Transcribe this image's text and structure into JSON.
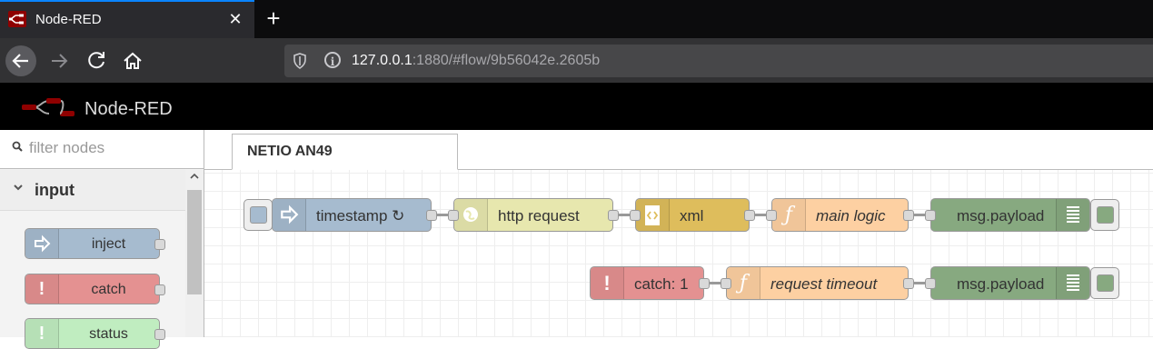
{
  "browser": {
    "tab_title": "Node-RED",
    "url_host": "127.0.0.1",
    "url_rest": ":1880/#flow/9b56042e.2605b"
  },
  "header": {
    "app_title": "Node-RED"
  },
  "palette": {
    "filter_placeholder": "filter nodes",
    "category": "input",
    "nodes": [
      {
        "label": "inject",
        "color": "#a6bbcf",
        "icon": "arrow-in-icon"
      },
      {
        "label": "catch",
        "color": "#e49191",
        "icon": "exclamation-icon"
      },
      {
        "label": "status",
        "color": "#c0edc0",
        "icon": "exclamation-icon"
      }
    ]
  },
  "workspace": {
    "flow_tab": "NETIO AN49",
    "flow1": [
      {
        "label": "timestamp ↻",
        "color": "#a6bbcf",
        "icon": "arrow-in-icon"
      },
      {
        "label": "http request",
        "color": "#e7e7ae",
        "icon": "globe-icon"
      },
      {
        "label": "xml",
        "color": "#debd5c",
        "icon": "xml-icon"
      },
      {
        "label": "main logic",
        "color": "#fdd0a2",
        "icon": "function-icon"
      },
      {
        "label": "msg.payload",
        "color": "#87a980",
        "icon": "debug-list-icon"
      }
    ],
    "flow2": [
      {
        "label": "catch: 1",
        "color": "#e49191",
        "icon": "exclamation-icon"
      },
      {
        "label": "request timeout",
        "color": "#fdd0a2",
        "icon": "function-icon"
      },
      {
        "label": "msg.payload",
        "color": "#87a980",
        "icon": "debug-list-icon"
      }
    ]
  }
}
